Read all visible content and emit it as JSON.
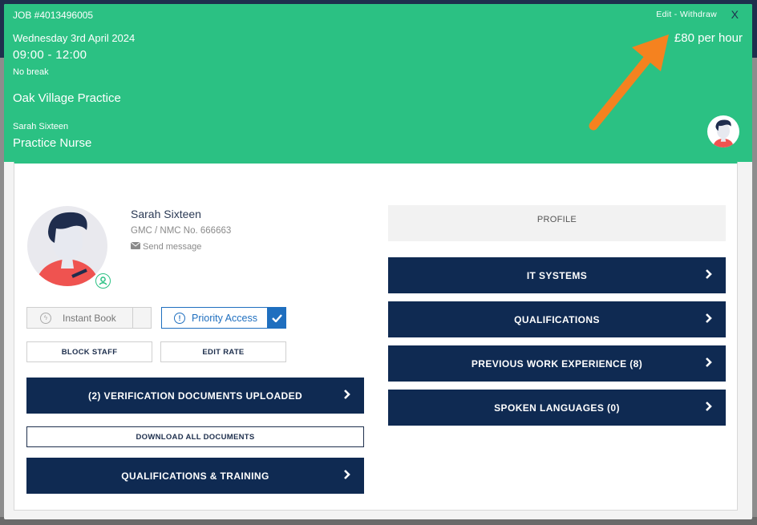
{
  "job": {
    "id": "JOB #4013496005",
    "date": "Wednesday 3rd April 2024",
    "time": "09:00 - 12:00",
    "break": "No break",
    "practice": "Oak Village Practice",
    "staff_name": "Sarah Sixteen",
    "role": "Practice Nurse",
    "rate": "£80 per hour",
    "edit_label": "Edit",
    "separator": " - ",
    "withdraw_label": "Withdraw",
    "close_label": "X"
  },
  "profile": {
    "name": "Sarah Sixteen",
    "gmc": "GMC / NMC No. 666663",
    "send_message": "Send message"
  },
  "actions": {
    "instant_book": "Instant Book",
    "priority_access": "Priority Access",
    "block_staff": "BLOCK STAFF",
    "edit_rate": "EDIT RATE",
    "verification": "(2) VERIFICATION DOCUMENTS UPLOADED",
    "download_all": "DOWNLOAD ALL DOCUMENTS",
    "qualifications_training": "QUALIFICATIONS & TRAINING"
  },
  "right_panel": {
    "profile_label": "PROFILE",
    "it_systems": "IT SYSTEMS",
    "qualifications": "QUALIFICATIONS",
    "previous_work": "PREVIOUS WORK EXPERIENCE (8)",
    "spoken_languages": "SPOKEN LANGUAGES (0)"
  },
  "colors": {
    "header_green": "#2bc183",
    "navy": "#0f2a52",
    "priority_blue": "#1f6fbf",
    "arrow_orange": "#f5821f"
  },
  "icons": [
    "envelope-icon",
    "bolt-icon",
    "info-icon",
    "check-icon",
    "chevron-right-icon",
    "user-badge-icon",
    "close-icon"
  ]
}
